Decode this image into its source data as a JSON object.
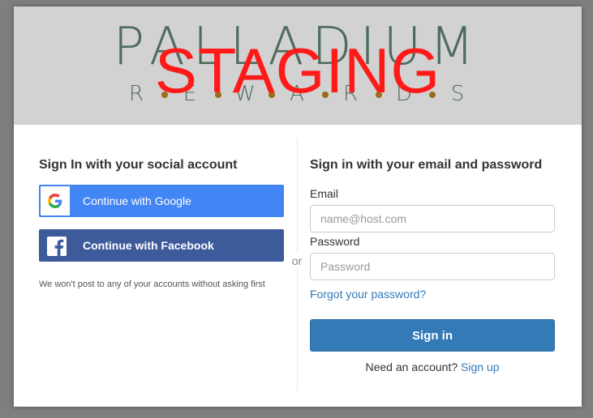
{
  "banner": {
    "logo_main": "PALLADIUM",
    "logo_sub_letters": [
      "R",
      "E",
      "W",
      "A",
      "R",
      "D",
      "S"
    ],
    "environment_label": "STAGING",
    "colors": {
      "logo": "#4d6b5c",
      "dots": "#9a6d1a",
      "staging": "#ff1a1a",
      "background": "#d2d2d2"
    }
  },
  "social": {
    "heading": "Sign In with your social account",
    "google_label": "Continue with Google",
    "facebook_label": "Continue with Facebook",
    "disclaimer": "We won't post to any of your accounts without asking first",
    "icons": {
      "google": "google-g-icon",
      "facebook": "facebook-f-icon"
    },
    "colors": {
      "google": "#4285f4",
      "facebook": "#3d5a9b"
    }
  },
  "separator": {
    "text": "or"
  },
  "email_signin": {
    "heading": "Sign in with your email and password",
    "email_label": "Email",
    "email_value": "",
    "email_placeholder": "name@host.com",
    "password_label": "Password",
    "password_value": "",
    "password_placeholder": "Password",
    "forgot_link": "Forgot your password?",
    "signin_button": "Sign in",
    "need_account_text": "Need an account?",
    "signup_link": "Sign up",
    "colors": {
      "primary": "#337ab7",
      "link": "#337ab7"
    }
  }
}
